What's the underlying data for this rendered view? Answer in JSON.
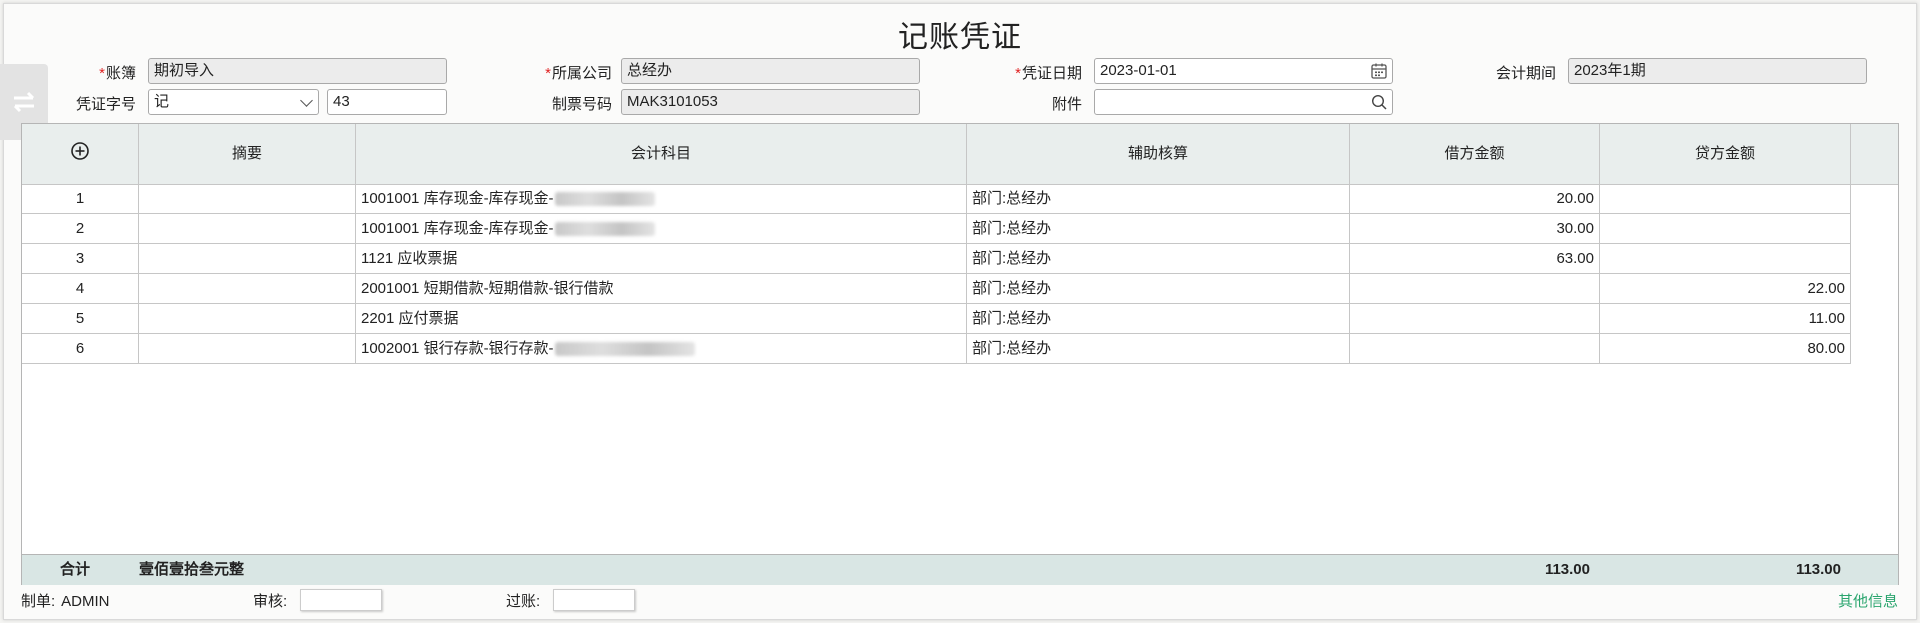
{
  "title": "记账凭证",
  "form": {
    "ledger_label": "账簿",
    "ledger_value": "期初导入",
    "company_label": "所属公司",
    "company_value": "总经办",
    "date_label": "凭证日期",
    "date_value": "2023-01-01",
    "period_label": "会计期间",
    "period_value": "2023年1期",
    "voucher_word_label": "凭证字号",
    "voucher_word_value": "记",
    "voucher_no_value": "43",
    "ticket_label": "制票号码",
    "ticket_value": "MAK3101053",
    "attach_label": "附件",
    "attach_value": ""
  },
  "table": {
    "headers": [
      "摘要",
      "会计科目",
      "辅助核算",
      "借方金额",
      "贷方金额"
    ],
    "rows": [
      {
        "no": "1",
        "summary": "",
        "account": "1001001 库存现金-库存现金-",
        "aux": "部门:总经办",
        "debit": "20.00",
        "credit": ""
      },
      {
        "no": "2",
        "summary": "",
        "account": "1001001 库存现金-库存现金-",
        "aux": "部门:总经办",
        "debit": "30.00",
        "credit": ""
      },
      {
        "no": "3",
        "summary": "",
        "account": "1121 应收票据",
        "aux": "部门:总经办",
        "debit": "63.00",
        "credit": ""
      },
      {
        "no": "4",
        "summary": "",
        "account": "2001001 短期借款-短期借款-银行借款",
        "aux": "部门:总经办",
        "debit": "",
        "credit": "22.00"
      },
      {
        "no": "5",
        "summary": "",
        "account": "2201 应付票据",
        "aux": "部门:总经办",
        "debit": "",
        "credit": "11.00"
      },
      {
        "no": "6",
        "summary": "",
        "account": "1002001 银行存款-银行存款-",
        "aux": "部门:总经办",
        "debit": "",
        "credit": "80.00"
      }
    ],
    "total_label": "合计",
    "total_words": "壹佰壹拾叁元整",
    "total_debit": "113.00",
    "total_credit": "113.00"
  },
  "footer": {
    "maker_label": "制单:",
    "maker_value": "ADMIN",
    "audit_label": "审核:",
    "post_label": "过账:",
    "more_label": "其他信息"
  },
  "colors": {
    "required": "#e02020",
    "link": "#2aa56e",
    "header_bg": "#e9eeed",
    "total_bg": "#d9e6e4"
  },
  "icons": [
    "add-row-icon",
    "calendar-icon",
    "search-icon",
    "switch-icon",
    "chevron-down-icon"
  ]
}
